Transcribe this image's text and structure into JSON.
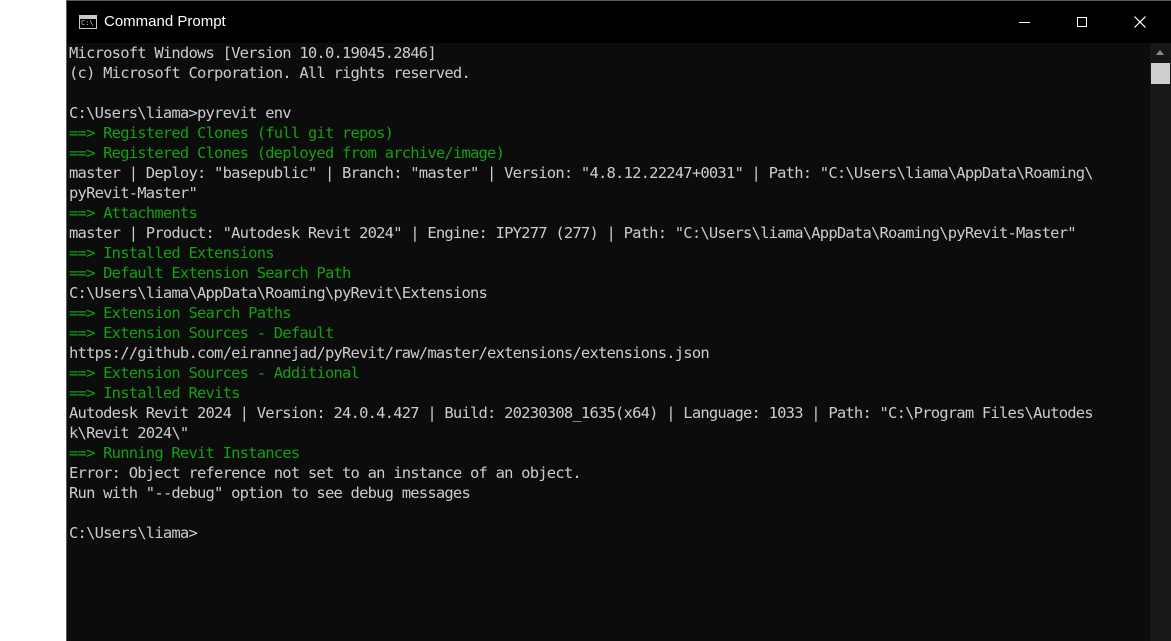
{
  "window": {
    "title": "Command Prompt",
    "icon_glyph": "C:\\"
  },
  "console": {
    "lines": [
      {
        "text": "Microsoft Windows [Version 10.0.19045.2846]",
        "color": "default"
      },
      {
        "text": "(c) Microsoft Corporation. All rights reserved.",
        "color": "default"
      },
      {
        "text": "",
        "color": "default"
      },
      {
        "text": "C:\\Users\\liama>pyrevit env",
        "color": "default"
      },
      {
        "text": "==> Registered Clones (full git repos)",
        "color": "green"
      },
      {
        "text": "==> Registered Clones (deployed from archive/image)",
        "color": "green"
      },
      {
        "text": "master | Deploy: \"basepublic\" | Branch: \"master\" | Version: \"4.8.12.22247+0031\" | Path: \"C:\\Users\\liama\\AppData\\Roaming\\",
        "color": "default"
      },
      {
        "text": "pyRevit-Master\"",
        "color": "default"
      },
      {
        "text": "==> Attachments",
        "color": "green"
      },
      {
        "text": "master | Product: \"Autodesk Revit 2024\" | Engine: IPY277 (277) | Path: \"C:\\Users\\liama\\AppData\\Roaming\\pyRevit-Master\"",
        "color": "default"
      },
      {
        "text": "==> Installed Extensions",
        "color": "green"
      },
      {
        "text": "==> Default Extension Search Path",
        "color": "green"
      },
      {
        "text": "C:\\Users\\liama\\AppData\\Roaming\\pyRevit\\Extensions",
        "color": "default"
      },
      {
        "text": "==> Extension Search Paths",
        "color": "green"
      },
      {
        "text": "==> Extension Sources - Default",
        "color": "green"
      },
      {
        "text": "https://github.com/eirannejad/pyRevit/raw/master/extensions/extensions.json",
        "color": "default"
      },
      {
        "text": "==> Extension Sources - Additional",
        "color": "green"
      },
      {
        "text": "==> Installed Revits",
        "color": "green"
      },
      {
        "text": "Autodesk Revit 2024 | Version: 24.0.4.427 | Build: 20230308_1635(x64) | Language: 1033 | Path: \"C:\\Program Files\\Autodes",
        "color": "default"
      },
      {
        "text": "k\\Revit 2024\\\"",
        "color": "default"
      },
      {
        "text": "==> Running Revit Instances",
        "color": "green"
      },
      {
        "text": "Error: Object reference not set to an instance of an object.",
        "color": "default"
      },
      {
        "text": "Run with \"--debug\" option to see debug messages",
        "color": "default"
      },
      {
        "text": "",
        "color": "default"
      },
      {
        "text": "C:\\Users\\liama>",
        "color": "default"
      }
    ]
  },
  "colors": {
    "background": "#0c0c0c",
    "default_text": "#cccccc",
    "green_text": "#13a10e",
    "titlebar": "#000000"
  },
  "icons": {
    "app": "command-prompt-icon",
    "minimize": "minimize-icon",
    "maximize": "maximize-icon",
    "close": "close-icon",
    "scroll_up": "scroll-up-arrow-icon"
  }
}
